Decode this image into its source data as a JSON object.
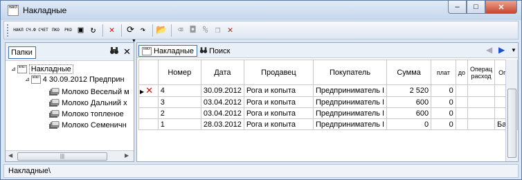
{
  "window": {
    "title": "Накладные",
    "icon_text": "НАКЛ",
    "controls": {
      "minimize": "–",
      "maximize": "□",
      "close": "✕"
    }
  },
  "toolbar": {
    "buttons": [
      {
        "id": "nakl",
        "text": "НАКЛ",
        "icon": "invoice-icon"
      },
      {
        "id": "sf",
        "text": "СЧ.Ф",
        "icon": "invoice-sf-icon"
      },
      {
        "id": "schet",
        "text": "СЧЕТ",
        "icon": "bill-icon"
      },
      {
        "id": "pko",
        "text": "ПКО",
        "icon": "cash-in-icon"
      },
      {
        "id": "rko",
        "text": "РКО",
        "icon": "cash-out-icon"
      },
      {
        "id": "report",
        "text": "",
        "icon": "report-icon"
      },
      {
        "id": "refresh",
        "text": "",
        "icon": "refresh-icon"
      },
      {
        "id": "delete",
        "text": "",
        "icon": "delete-icon"
      },
      {
        "id": "sync",
        "text": "",
        "icon": "sync-icon"
      },
      {
        "id": "redo",
        "text": "",
        "icon": "redo-icon"
      },
      {
        "id": "folder",
        "text": "",
        "icon": "folder-icon"
      },
      {
        "id": "erase",
        "text": "",
        "icon": "eraser-icon"
      },
      {
        "id": "stamp",
        "text": "",
        "icon": "stamp-icon"
      },
      {
        "id": "percent",
        "text": "",
        "icon": "percent-icon"
      },
      {
        "id": "copy",
        "text": "",
        "icon": "copy-icon"
      },
      {
        "id": "remove",
        "text": "",
        "icon": "remove-icon"
      }
    ]
  },
  "left_panel": {
    "tab_label": "Папки",
    "tree": {
      "root": "Накладные",
      "doc": "4 30.09.2012 Предприн",
      "items": [
        "Молоко Веселый м",
        "Молоко Дальний х",
        "Молоко топленое",
        "Молоко Семеничн"
      ]
    }
  },
  "right_panel": {
    "tabs": [
      {
        "label": "Накладные",
        "icon_text": "НАКЛ"
      },
      {
        "label": "Поиск",
        "icon": "binoculars-icon"
      }
    ],
    "columns": [
      "",
      "Номер",
      "Дата",
      "Продавец",
      "Покупатель",
      "Сумма",
      "плат",
      "до",
      "Операц расход",
      "Опер"
    ],
    "rows": [
      {
        "cells": [
          "4",
          "30.09.2012",
          "Рога и копыта",
          "Предприниматель I",
          "2 520",
          "0",
          "",
          "",
          ""
        ],
        "current": true,
        "deleted": true
      },
      {
        "cells": [
          "3",
          "03.04.2012",
          "Рога и копыта",
          "Предприниматель I",
          "600",
          "0",
          "",
          "",
          ""
        ]
      },
      {
        "cells": [
          "2",
          "03.04.2012",
          "Рога и копыта",
          "Предприниматель I",
          "600",
          "0",
          "",
          "",
          ""
        ]
      },
      {
        "cells": [
          "1",
          "28.03.2012",
          "Рога и копыта",
          "Предприниматель I",
          "0",
          "0",
          "",
          "",
          "Банк"
        ]
      }
    ]
  },
  "status": {
    "text": "Накладные\\"
  }
}
